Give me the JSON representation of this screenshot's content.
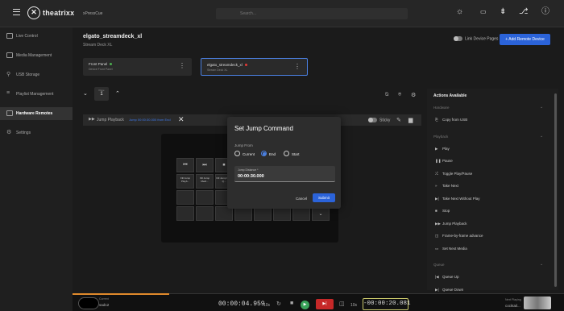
{
  "header": {
    "logo_mark": "✕",
    "logo_text": "theatrixx",
    "project": "xPressCue",
    "search_placeholder": "Search..."
  },
  "sidebar": {
    "items": [
      {
        "label": "Live Control",
        "active": false
      },
      {
        "label": "Media Management",
        "active": false
      },
      {
        "label": "USB Storage",
        "active": false
      },
      {
        "label": "Playlist Management",
        "active": false
      },
      {
        "label": "Hardware Remotes",
        "active": true
      },
      {
        "label": "Settings",
        "active": false
      }
    ]
  },
  "device": {
    "title": "elgato_streamdeck_xl",
    "subtitle": "Stream Deck XL",
    "link_pages": "Link Device Pages",
    "add_remote": "+ Add Remote Device",
    "panels": [
      {
        "name": "Front Panel",
        "sub": "Device Front Panel",
        "status": "green"
      },
      {
        "name": "elgato_streamdeck_xl",
        "sub": "Stream Deck XL",
        "status": "red"
      }
    ]
  },
  "page_selector": {
    "label": "Page",
    "value": "1"
  },
  "action_bar": {
    "name": "Jump Playback",
    "detail": "Jump 00:00:30.000 from End",
    "sticky": "Sticky"
  },
  "keys": [
    {
      "icon": "⏮",
      "text": ""
    },
    {
      "icon": "⏭",
      "text": ""
    },
    {
      "icon": "⏹",
      "text": ""
    },
    {
      "icon": "",
      "text": "Fill Jump Playb..."
    },
    {
      "icon": "",
      "text": "Fill Jump Medi..."
    },
    {
      "icon": "",
      "text": "Fill Jump Next Q..."
    }
  ],
  "modal": {
    "title": "Set Jump Command",
    "jump_from_label": "Jump From",
    "options": [
      "Current",
      "End",
      "Start"
    ],
    "selected": "End",
    "field_label": "Jump Distance *",
    "field_value": "00:00:30.000",
    "cancel": "Cancel",
    "submit": "Submit"
  },
  "actions_panel": {
    "title": "Actions Available",
    "categories": [
      {
        "name": "Hardware",
        "items": [
          {
            "icon": "⎘",
            "label": "Copy from USB"
          }
        ]
      },
      {
        "name": "Playback",
        "items": [
          {
            "icon": "▶",
            "label": "Play"
          },
          {
            "icon": "❚❚",
            "label": "Pause"
          },
          {
            "icon": "⤮",
            "label": "Toggle Play/Pause"
          },
          {
            "icon": "»",
            "label": "Take Next"
          },
          {
            "icon": "▶|",
            "label": "Take Next Without Play"
          },
          {
            "icon": "■",
            "label": "Stop"
          },
          {
            "icon": "▶▶",
            "label": "Jump Playback"
          },
          {
            "icon": "◫",
            "label": "Frame-by-frame advance"
          },
          {
            "icon": "▭",
            "label": "Set Next Media"
          }
        ]
      },
      {
        "name": "Queue",
        "items": [
          {
            "icon": "|◀",
            "label": "Queue Up"
          },
          {
            "icon": "▶|",
            "label": "Queue Down"
          }
        ]
      }
    ]
  },
  "transport": {
    "cue_label": "Current",
    "cue_name": "sad12",
    "elapsed": "00:00:04.959",
    "step_left": "10s",
    "step_right": "10s",
    "remaining": "-00:00:20.081",
    "next_label": "Next Playing",
    "next_name": "cocktail..."
  }
}
